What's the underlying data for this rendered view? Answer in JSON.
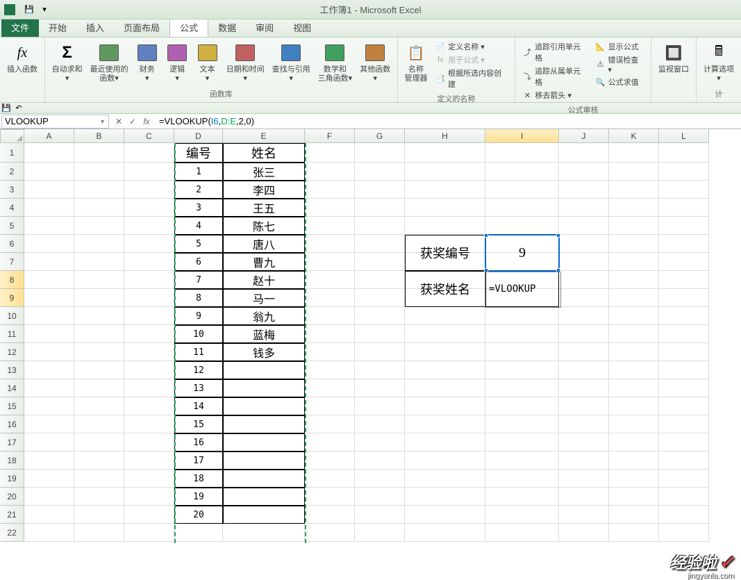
{
  "title": "工作簿1 - Microsoft Excel",
  "menu": {
    "file": "文件",
    "items": [
      "开始",
      "插入",
      "页面布局",
      "公式",
      "数据",
      "审阅",
      "视图"
    ],
    "active_index": 3
  },
  "ribbon": {
    "groups": [
      {
        "label": "",
        "buttons": [
          {
            "label": "插入函数",
            "icon": "fx"
          }
        ]
      },
      {
        "label": "函数库",
        "buttons": [
          {
            "label": "自动求和\n▾",
            "icon": "Σ",
            "color": "#c0a060"
          },
          {
            "label": "最近使用的\n函数▾",
            "icon": "📗",
            "color": "#609860"
          },
          {
            "label": "财务\n▾",
            "icon": "📘",
            "color": "#6080c0"
          },
          {
            "label": "逻辑\n▾",
            "icon": "📙",
            "color": "#b060b0"
          },
          {
            "label": "文本\n▾",
            "icon": "📒",
            "color": "#d0b040"
          },
          {
            "label": "日期和时间\n▾",
            "icon": "📕",
            "color": "#c06060"
          },
          {
            "label": "查找与引用\n▾",
            "icon": "📘",
            "color": "#4080c0"
          },
          {
            "label": "数学和\n三角函数▾",
            "icon": "📗",
            "color": "#40a060"
          },
          {
            "label": "其他函数\n▾",
            "icon": "📚",
            "color": "#c08040"
          }
        ]
      },
      {
        "label": "定义的名称",
        "big": [
          {
            "label": "名称\n管理器",
            "icon": "📋"
          }
        ],
        "small": [
          {
            "label": "定义名称 ▾",
            "icon": "📄"
          },
          {
            "label": "用于公式 ▾",
            "icon": "fx"
          },
          {
            "label": "根据所选内容创建",
            "icon": "📑"
          }
        ]
      },
      {
        "label": "公式审核",
        "cols": [
          [
            {
              "label": "追踪引用单元格",
              "icon": "⤴"
            },
            {
              "label": "追踪从属单元格",
              "icon": "⤵"
            },
            {
              "label": "移去箭头 ▾",
              "icon": "✕"
            }
          ],
          [
            {
              "label": "显示公式",
              "icon": "📐"
            },
            {
              "label": "错误检查 ▾",
              "icon": "⚠"
            },
            {
              "label": "公式求值",
              "icon": "🔍"
            }
          ]
        ]
      },
      {
        "label": "",
        "buttons": [
          {
            "label": "监视窗口",
            "icon": "🔲"
          }
        ]
      },
      {
        "label": "计",
        "buttons": [
          {
            "label": "计算选项\n▾",
            "icon": "🖩"
          }
        ]
      }
    ]
  },
  "formula_bar": {
    "name_box": "VLOOKUP",
    "formula_raw": "=VLOOKUP(I6,D:E,2,0)",
    "formula_parts": [
      "=VLOOKUP(",
      "I6",
      ",",
      "D:E",
      ",",
      "2",
      ",",
      "0",
      ")"
    ]
  },
  "columns": [
    "A",
    "B",
    "C",
    "D",
    "E",
    "F",
    "G",
    "H",
    "I",
    "J",
    "K",
    "L"
  ],
  "highlighted_col": "I",
  "highlighted_rows": [
    8,
    9
  ],
  "row_count": 22,
  "row_heights": {
    "1": 28
  },
  "table_de": {
    "headers": [
      "编号",
      "姓名"
    ],
    "rows": [
      [
        "1",
        "张三"
      ],
      [
        "2",
        "李四"
      ],
      [
        "3",
        "王五"
      ],
      [
        "4",
        "陈七"
      ],
      [
        "5",
        "唐八"
      ],
      [
        "6",
        "曹九"
      ],
      [
        "7",
        "赵十"
      ],
      [
        "8",
        "马一"
      ],
      [
        "9",
        "翁九"
      ],
      [
        "10",
        "蓝梅"
      ],
      [
        "11",
        "钱多"
      ],
      [
        "12",
        ""
      ],
      [
        "13",
        ""
      ],
      [
        "14",
        ""
      ],
      [
        "15",
        ""
      ],
      [
        "16",
        ""
      ],
      [
        "17",
        ""
      ],
      [
        "18",
        ""
      ],
      [
        "19",
        ""
      ],
      [
        "20",
        ""
      ]
    ]
  },
  "lookup_box": {
    "rows": [
      {
        "label": "获奖编号",
        "value": "9"
      },
      {
        "label": "获奖姓名",
        "value": "=VLOOKUP"
      }
    ]
  },
  "watermark": {
    "text": "经验啦",
    "check": "✓",
    "sub": "jingyanla.com"
  }
}
